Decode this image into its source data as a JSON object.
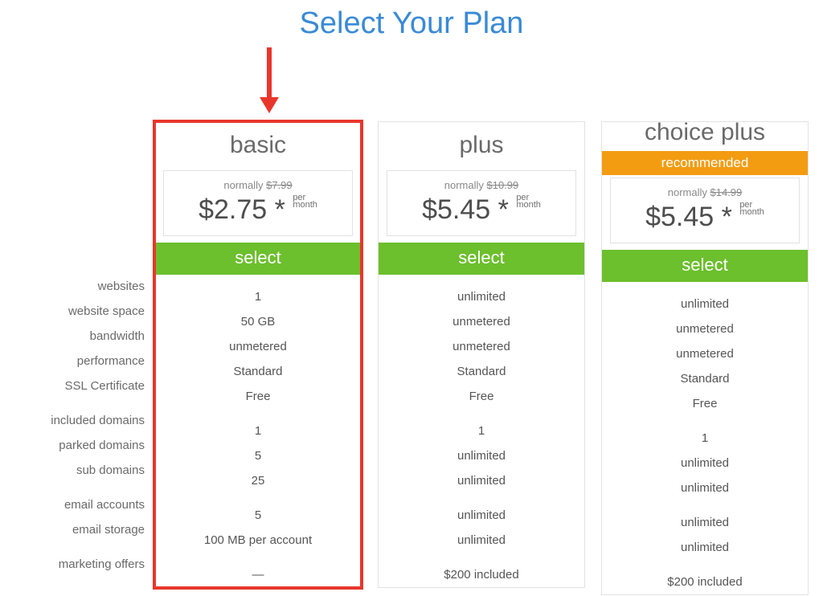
{
  "title": "Select Your Plan",
  "labels": {
    "websites": "websites",
    "website_space": "website space",
    "bandwidth": "bandwidth",
    "performance": "performance",
    "ssl": "SSL Certificate",
    "included_domains": "included domains",
    "parked_domains": "parked domains",
    "sub_domains": "sub domains",
    "email_accounts": "email accounts",
    "email_storage": "email storage",
    "marketing_offers": "marketing offers"
  },
  "plans": {
    "basic": {
      "name": "basic",
      "normally_label": "normally ",
      "normally_price": "$7.99",
      "price": "$2.75",
      "star": " * ",
      "per1": "per",
      "per2": "month",
      "select": "select",
      "features": {
        "websites": "1",
        "website_space": "50 GB",
        "bandwidth": "unmetered",
        "performance": "Standard",
        "ssl": "Free",
        "included_domains": "1",
        "parked_domains": "5",
        "sub_domains": "25",
        "email_accounts": "5",
        "email_storage": "100 MB per account",
        "marketing_offers": "—"
      }
    },
    "plus": {
      "name": "plus",
      "normally_label": "normally ",
      "normally_price": "$10.99",
      "price": "$5.45",
      "star": " * ",
      "per1": "per",
      "per2": "month",
      "select": "select",
      "features": {
        "websites": "unlimited",
        "website_space": "unmetered",
        "bandwidth": "unmetered",
        "performance": "Standard",
        "ssl": "Free",
        "included_domains": "1",
        "parked_domains": "unlimited",
        "sub_domains": "unlimited",
        "email_accounts": "unlimited",
        "email_storage": "unlimited",
        "marketing_offers": "$200 included"
      }
    },
    "choice": {
      "name": "choice plus",
      "badge": "recommended",
      "normally_label": "normally ",
      "normally_price": "$14.99",
      "price": "$5.45",
      "star": " * ",
      "per1": "per",
      "per2": "month",
      "select": "select",
      "features": {
        "websites": "unlimited",
        "website_space": "unmetered",
        "bandwidth": "unmetered",
        "performance": "Standard",
        "ssl": "Free",
        "included_domains": "1",
        "parked_domains": "unlimited",
        "sub_domains": "unlimited",
        "email_accounts": "unlimited",
        "email_storage": "unlimited",
        "marketing_offers": "$200 included"
      }
    }
  }
}
